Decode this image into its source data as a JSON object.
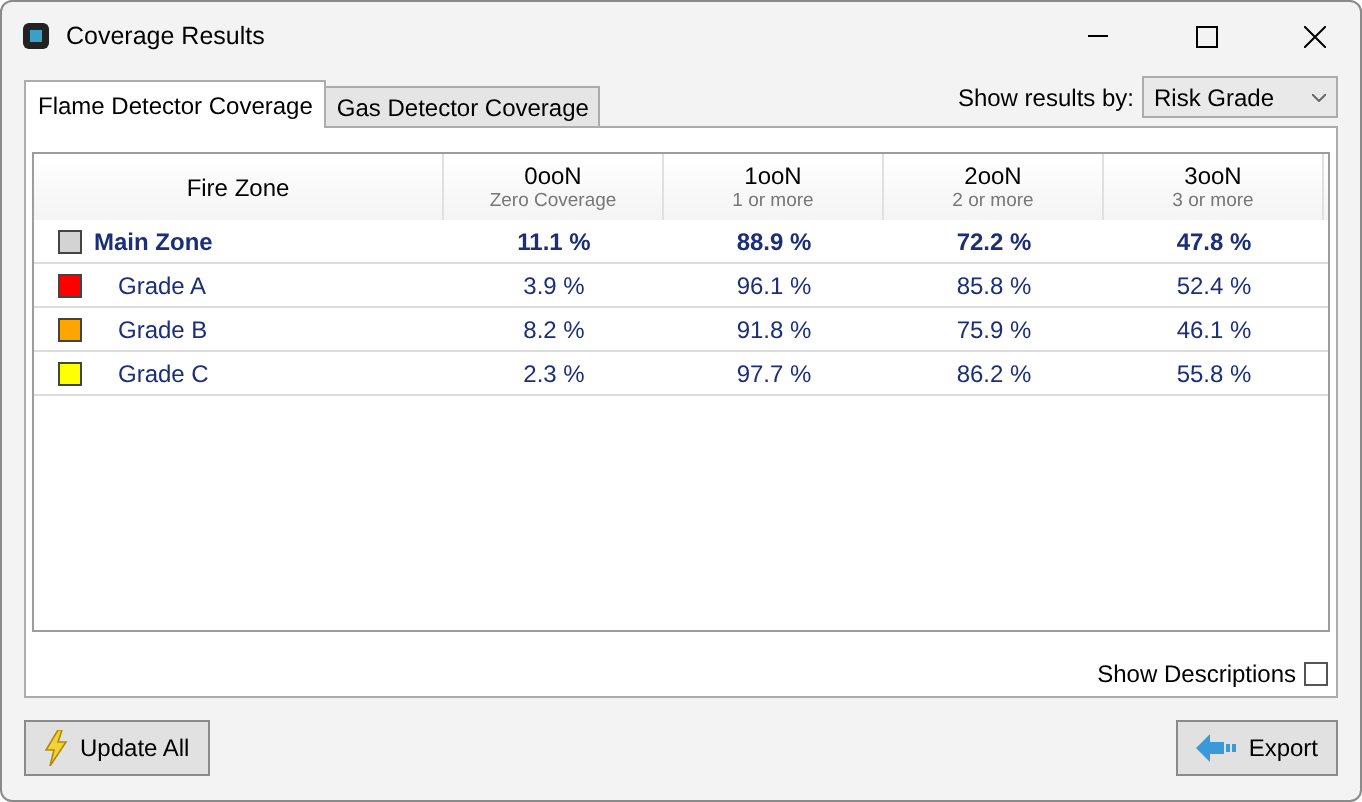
{
  "window": {
    "title": "Coverage Results"
  },
  "tabs": [
    {
      "label": "Flame Detector Coverage",
      "selected": true
    },
    {
      "label": "Gas Detector Coverage",
      "selected": false
    }
  ],
  "show_results_by": {
    "label": "Show results by:",
    "value": "Risk Grade"
  },
  "table": {
    "columns": [
      {
        "title": "Fire Zone"
      },
      {
        "title": "0ooN",
        "subtitle": "Zero Coverage"
      },
      {
        "title": "1ooN",
        "subtitle": "1 or more"
      },
      {
        "title": "2ooN",
        "subtitle": "2 or more"
      },
      {
        "title": "3ooN",
        "subtitle": "3 or more"
      }
    ],
    "rows": [
      {
        "kind": "group",
        "name": "Main Zone",
        "color": "#d3d3d3",
        "values": [
          "11.1 %",
          "88.9 %",
          "72.2 %",
          "47.8 %"
        ]
      },
      {
        "kind": "item",
        "name": "Grade A",
        "color": "#ff0000",
        "values": [
          "3.9 %",
          "96.1 %",
          "85.8 %",
          "52.4 %"
        ]
      },
      {
        "kind": "item",
        "name": "Grade B",
        "color": "#ffa500",
        "values": [
          "8.2 %",
          "91.8 %",
          "75.9 %",
          "46.1 %"
        ]
      },
      {
        "kind": "item",
        "name": "Grade C",
        "color": "#ffff00",
        "values": [
          "2.3 %",
          "97.7 %",
          "86.2 %",
          "55.8 %"
        ]
      }
    ]
  },
  "show_descriptions": {
    "label": "Show Descriptions",
    "checked": false
  },
  "buttons": [
    {
      "kind": "update",
      "label": "Update All"
    },
    {
      "kind": "export",
      "label": "Export"
    }
  ]
}
